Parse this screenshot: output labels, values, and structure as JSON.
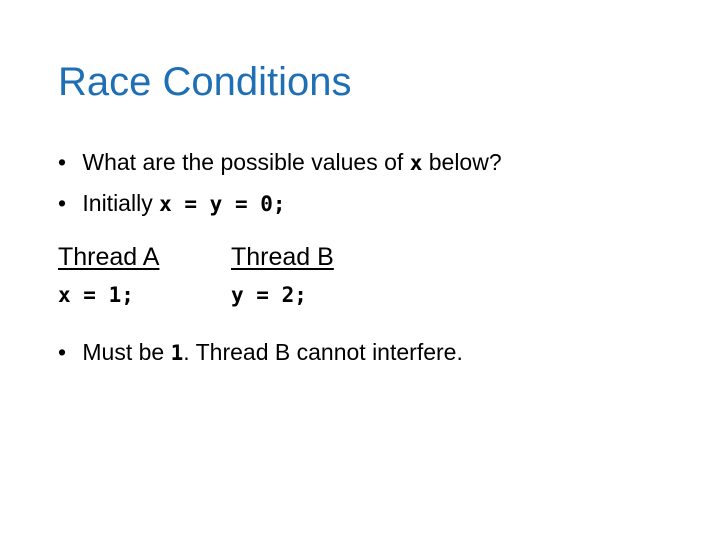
{
  "slide": {
    "title": "Race Conditions",
    "bullets": [
      {
        "bullet": "•",
        "pre": " What are the possible values of ",
        "code": "x",
        "post": " below?"
      },
      {
        "bullet": "•",
        "pre": " Initially ",
        "code": "x = y = 0;",
        "post": ""
      },
      {
        "bullet": "•",
        "pre": " Must be ",
        "code": "1",
        "post": ". Thread B cannot interfere."
      }
    ],
    "threads": [
      {
        "header": "Thread A",
        "code": "x = 1;"
      },
      {
        "header": "Thread B",
        "code": "y = 2;"
      }
    ],
    "title_color": "#1f6fb5"
  }
}
